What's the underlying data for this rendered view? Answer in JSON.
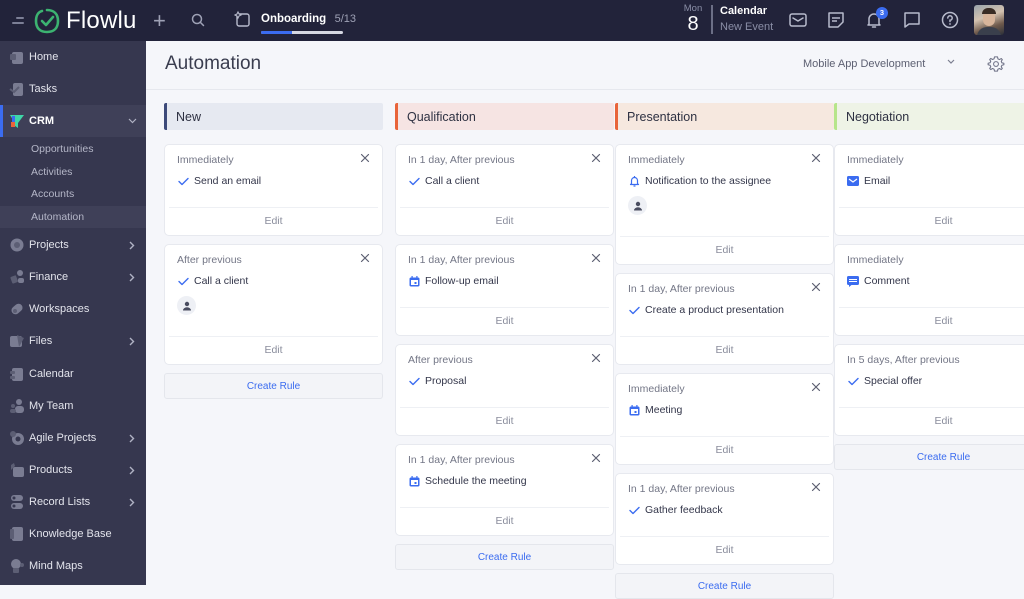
{
  "topbar": {
    "logo_text": "Flowlu",
    "onboarding": {
      "title": "Onboarding",
      "count": "5/13",
      "progress_fraction": 0.38
    },
    "date": {
      "weekday": "Mon",
      "day": "8"
    },
    "calendar": {
      "title": "Calendar",
      "subtitle": "New Event"
    },
    "notifications_badge": "3"
  },
  "sidebar": {
    "items": [
      {
        "label": "Home",
        "icon": "home-icon",
        "chevron": ""
      },
      {
        "label": "Tasks",
        "icon": "tasks-icon",
        "chevron": ""
      },
      {
        "label": "CRM",
        "icon": "crm-icon",
        "chevron": "⌄"
      },
      {
        "label": "Projects",
        "icon": "projects-icon",
        "chevron": "›"
      },
      {
        "label": "Finance",
        "icon": "finance-icon",
        "chevron": "›"
      },
      {
        "label": "Workspaces",
        "icon": "workspaces-icon",
        "chevron": ""
      },
      {
        "label": "Files",
        "icon": "files-icon",
        "chevron": "›"
      },
      {
        "label": "Calendar",
        "icon": "calendar-icon",
        "chevron": ""
      },
      {
        "label": "My Team",
        "icon": "team-icon",
        "chevron": ""
      },
      {
        "label": "Agile Projects",
        "icon": "agile-icon",
        "chevron": "›"
      },
      {
        "label": "Products",
        "icon": "products-icon",
        "chevron": "›"
      },
      {
        "label": "Record Lists",
        "icon": "record-lists-icon",
        "chevron": "›"
      },
      {
        "label": "Knowledge Base",
        "icon": "knowledge-base-icon",
        "chevron": ""
      },
      {
        "label": "Mind Maps",
        "icon": "mind-maps-icon",
        "chevron": ""
      }
    ],
    "crm_sub": [
      "Opportunities",
      "Activities",
      "Accounts",
      "Automation"
    ]
  },
  "main": {
    "title": "Automation",
    "project_select": "Mobile App Development",
    "edit_label": "Edit",
    "create_rule_label": "Create Rule",
    "columns": [
      {
        "name": "New",
        "accent": "#3d4a7a",
        "bg": "#e6e9f1",
        "cards": [
          {
            "when": "Immediately",
            "action": "Send an email",
            "icon": "check",
            "assignee": false
          },
          {
            "when": "After previous",
            "action": "Call a client",
            "icon": "check",
            "assignee": true
          }
        ]
      },
      {
        "name": "Qualification",
        "accent": "#e8643a",
        "bg": "#f6e4e3",
        "cards": [
          {
            "when": "In 1 day, After previous",
            "action": "Call a client",
            "icon": "check",
            "assignee": false
          },
          {
            "when": "In 1 day, After previous",
            "action": "Follow-up email",
            "icon": "calendar",
            "assignee": false
          },
          {
            "when": "After previous",
            "action": "Proposal",
            "icon": "check",
            "assignee": false
          },
          {
            "when": "In 1 day, After previous",
            "action": "Schedule the meeting",
            "icon": "calendar",
            "assignee": false
          }
        ]
      },
      {
        "name": "Presentation",
        "accent": "#e8643a",
        "bg": "#f6e8df",
        "cards": [
          {
            "when": "Immediately",
            "action": "Notification to the assignee",
            "icon": "bell",
            "assignee": true
          },
          {
            "when": "In 1 day, After previous",
            "action": "Create a product presentation",
            "icon": "check",
            "assignee": false
          },
          {
            "when": "Immediately",
            "action": "Meeting",
            "icon": "calendar",
            "assignee": false
          },
          {
            "when": "In 1 day, After previous",
            "action": "Gather feedback",
            "icon": "check",
            "assignee": false
          }
        ]
      },
      {
        "name": "Negotiation",
        "accent": "#b6e58a",
        "bg": "#eef3e6",
        "cards": [
          {
            "when": "Immediately",
            "action": "Email",
            "icon": "email",
            "assignee": false
          },
          {
            "when": "Immediately",
            "action": "Comment",
            "icon": "comment",
            "assignee": false
          },
          {
            "when": "In 5 days, After previous",
            "action": "Special offer",
            "icon": "check",
            "assignee": false
          }
        ]
      }
    ]
  },
  "colors": {
    "accent": "#3b6cf0",
    "topbar_bg": "#22233a",
    "sidebar_bg": "#36374f"
  }
}
